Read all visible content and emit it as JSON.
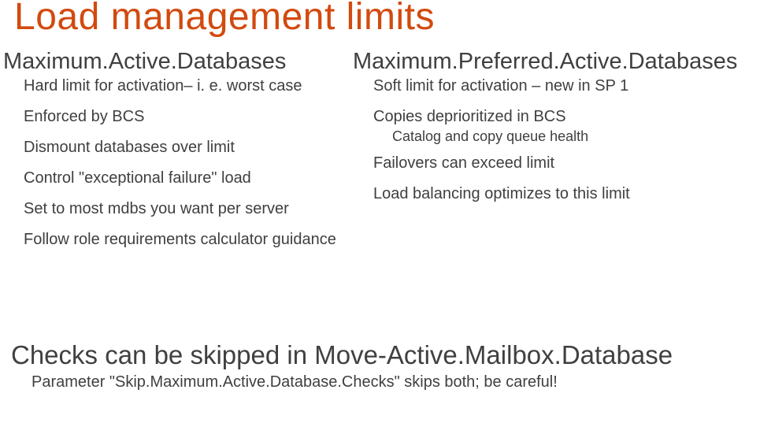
{
  "title": "Load management limits",
  "left": {
    "heading": "Maximum.Active.Databases",
    "b1": "Hard limit for activation– i. e. worst case",
    "b2": "Enforced by BCS",
    "b3": "Dismount databases over limit",
    "b4": "Control \"exceptional failure\" load",
    "b5": "Set to most mdbs you want per server",
    "b6": "Follow role requirements calculator guidance"
  },
  "right": {
    "heading": "Maximum.Preferred.Active.Databases",
    "b1": "Soft limit for activation – new in SP 1",
    "b2": "Copies deprioritized in BCS",
    "b2a": "Catalog and copy queue health",
    "b3": "Failovers can exceed limit",
    "b4": "Load balancing optimizes to this limit"
  },
  "footer": {
    "heading": "Checks can be skipped in Move-Active.Mailbox.Database",
    "body": "Parameter \"Skip.Maximum.Active.Database.Checks\" skips both; be careful!"
  }
}
